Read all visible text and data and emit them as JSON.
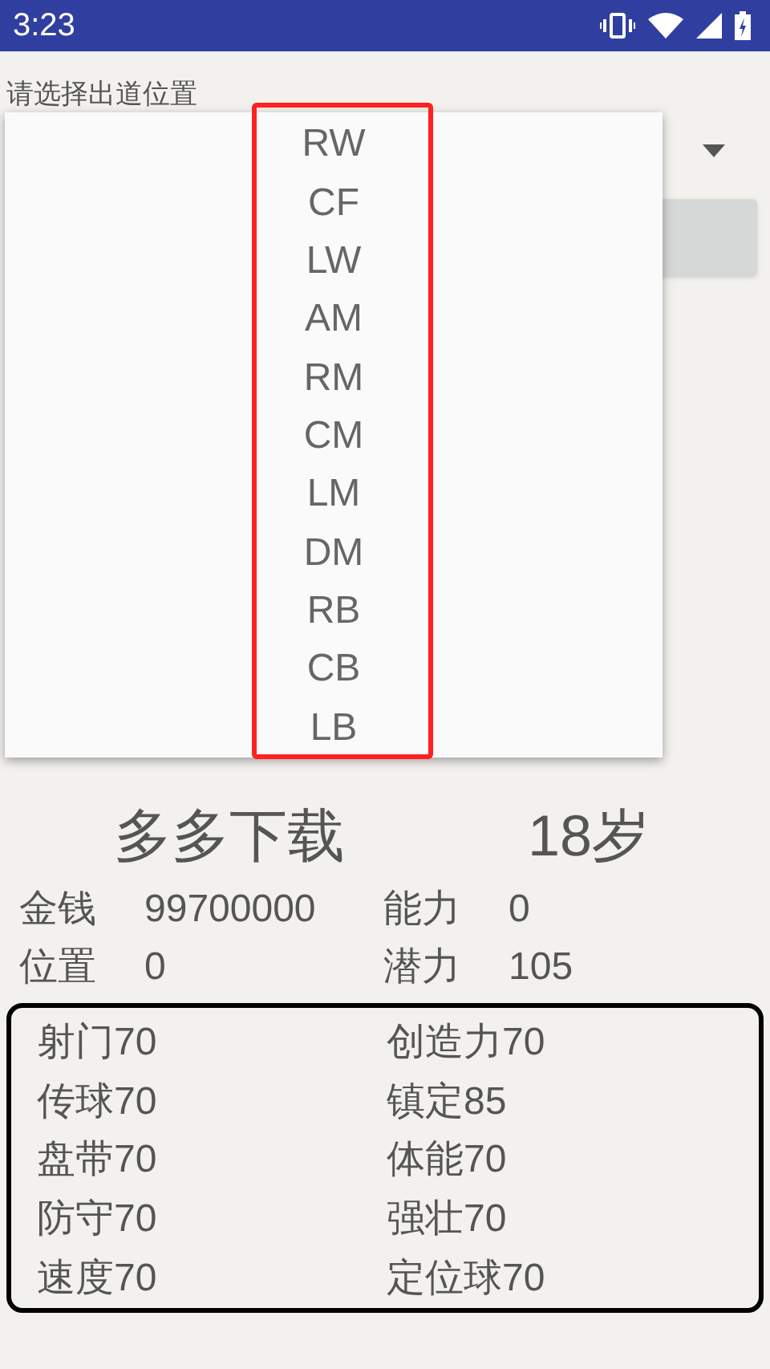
{
  "status_bar": {
    "time": "3:23"
  },
  "position_prompt": "请选择出道位置",
  "position_dropdown": {
    "options": [
      {
        "label": "RW"
      },
      {
        "label": "CF"
      },
      {
        "label": "LW"
      },
      {
        "label": "AM"
      },
      {
        "label": "RM"
      },
      {
        "label": "CM"
      },
      {
        "label": "LM"
      },
      {
        "label": "DM"
      },
      {
        "label": "RB"
      },
      {
        "label": "CB"
      },
      {
        "label": "LB"
      }
    ]
  },
  "player": {
    "name": "多多下载",
    "age": "18岁"
  },
  "info": [
    {
      "label": "金钱",
      "value": "99700000"
    },
    {
      "label": "能力",
      "value": "0"
    },
    {
      "label": "位置",
      "value": "0"
    },
    {
      "label": "潜力",
      "value": "105"
    }
  ],
  "attributes": [
    {
      "text": "射门70"
    },
    {
      "text": "创造力70"
    },
    {
      "text": "传球70"
    },
    {
      "text": "镇定85"
    },
    {
      "text": "盘带70"
    },
    {
      "text": "体能70"
    },
    {
      "text": "防守70"
    },
    {
      "text": "强壮70"
    },
    {
      "text": "速度70"
    },
    {
      "text": "定位球70"
    }
  ]
}
